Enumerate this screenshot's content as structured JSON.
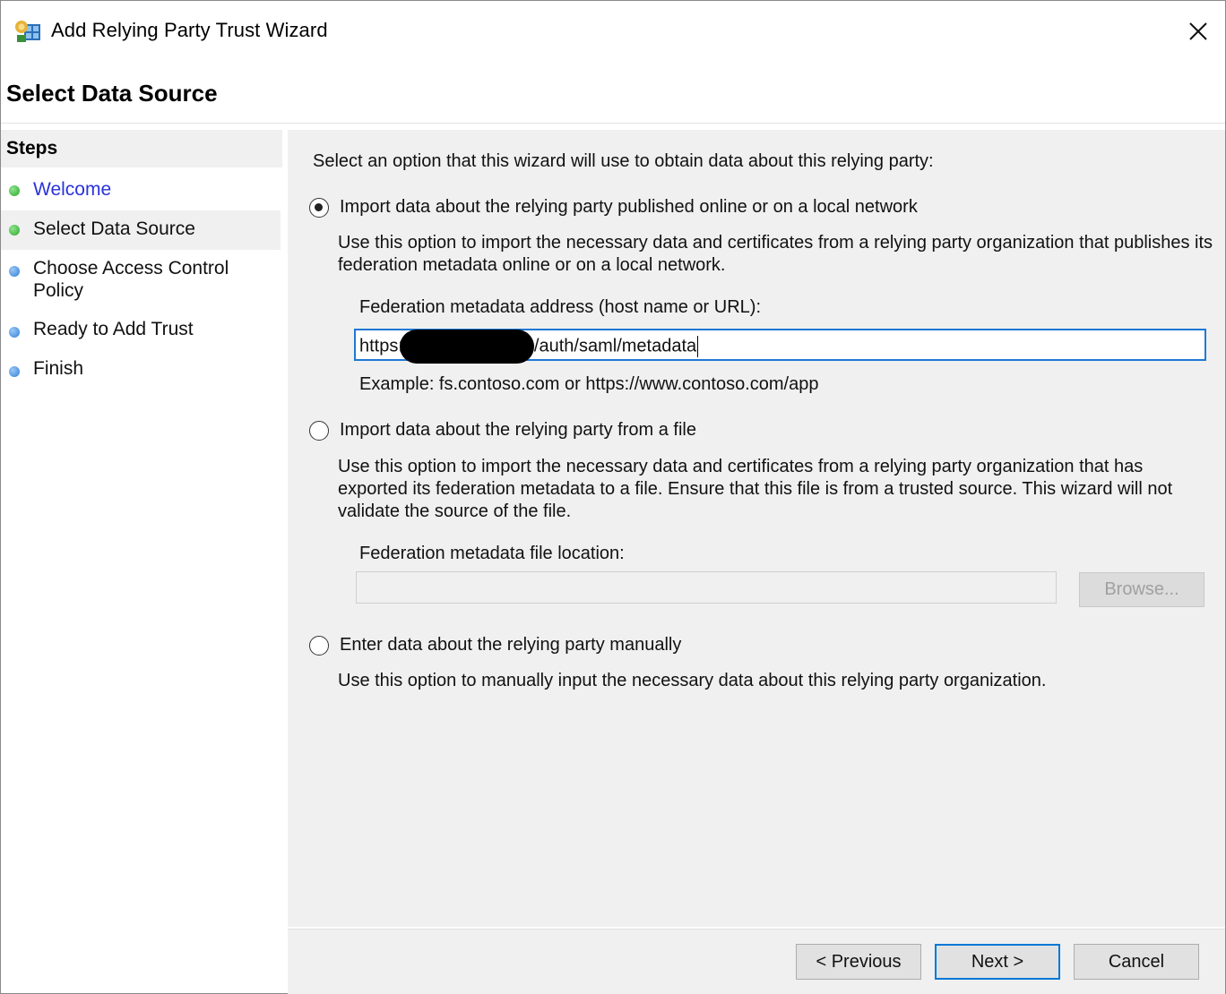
{
  "window": {
    "title": "Add Relying Party Trust Wizard"
  },
  "header": {
    "title": "Select Data Source"
  },
  "steps": {
    "heading": "Steps",
    "items": [
      {
        "label": "Welcome",
        "state": "completed",
        "dot_color": "#2aa82a"
      },
      {
        "label": "Select Data Source",
        "state": "current",
        "dot_color": "#2aa82a"
      },
      {
        "label": "Choose Access Control Policy",
        "state": "pending",
        "dot_color": "#2d7fd6"
      },
      {
        "label": "Ready to Add Trust",
        "state": "pending",
        "dot_color": "#2d7fd6"
      },
      {
        "label": "Finish",
        "state": "pending",
        "dot_color": "#2d7fd6"
      }
    ]
  },
  "main": {
    "intro": "Select an option that this wizard will use to obtain data about this relying party:",
    "option_online": {
      "label": "Import data about the relying party published online or on a local network",
      "selected": true,
      "description": "Use this option to import the necessary data and certificates from a relying party organization that publishes its federation metadata online or on a local network.",
      "field_label": "Federation metadata address (host name or URL):",
      "value_prefix": "https:",
      "value_suffix": "/auth/saml/metadata",
      "example": "Example: fs.contoso.com or https://www.contoso.com/app"
    },
    "option_file": {
      "label": "Import data about the relying party from a file",
      "selected": false,
      "description": "Use this option to import the necessary data and certificates from a relying party organization that has exported its federation metadata to a file. Ensure that this file is from a trusted source.  This wizard will not validate the source of the file.",
      "field_label": "Federation metadata file location:",
      "value": "",
      "browse_label": "Browse..."
    },
    "option_manual": {
      "label": "Enter data about the relying party manually",
      "selected": false,
      "description": "Use this option to manually input the necessary data about this relying party organization."
    }
  },
  "footer": {
    "previous_label": "< Previous",
    "next_label": "Next >",
    "cancel_label": "Cancel"
  },
  "colors": {
    "accent": "#0078d7",
    "link": "#2a32d9",
    "panel": "#f0f0f0"
  }
}
